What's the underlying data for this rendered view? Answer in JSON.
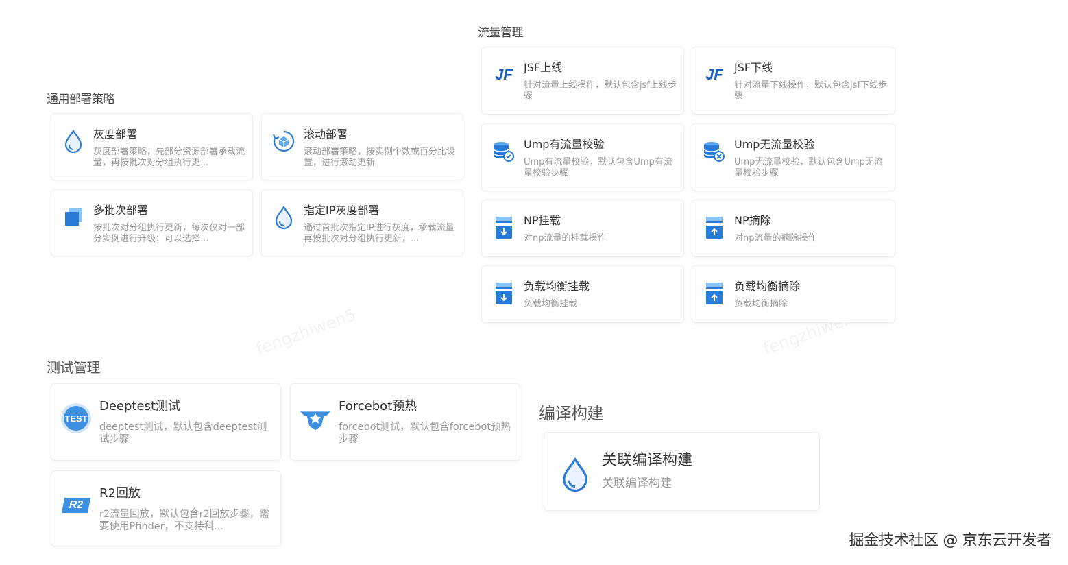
{
  "sections": {
    "deploy": "通用部署策略",
    "traffic": "流量管理",
    "test": "测试管理",
    "build": "编译构建"
  },
  "deploy_cards": [
    {
      "title": "灰度部署",
      "desc": "灰度部署策略，先部分资源部署承载流量，再按批次对分组执行更..."
    },
    {
      "title": "滚动部署",
      "desc": "滚动部署策略，按实例个数或百分比设置，进行滚动更新"
    },
    {
      "title": "多批次部署",
      "desc": "按批次对分组执行更新，每次仅对一部分实例进行升级；可以选择..."
    },
    {
      "title": "指定IP灰度部署",
      "desc": "通过首批次指定IP进行灰度，承载流量再按批次对分组执行更新，..."
    }
  ],
  "traffic_cards": [
    {
      "title": "JSF上线",
      "desc": "针对流量上线操作，默认包含jsf上线步骤",
      "icon_text": "JF"
    },
    {
      "title": "JSF下线",
      "desc": "针对流量下线操作，默认包含jsf下线步骤",
      "icon_text": "JF"
    },
    {
      "title": "Ump有流量校验",
      "desc": "Ump有流量校验，默认包含Ump有流量校验步骤"
    },
    {
      "title": "Ump无流量校验",
      "desc": "Ump无流量校验，默认包含Ump无流量校验步骤"
    },
    {
      "title": "NP挂载",
      "desc": "对np流量的挂载操作"
    },
    {
      "title": "NP摘除",
      "desc": "对np流量的摘除操作"
    },
    {
      "title": "负载均衡挂载",
      "desc": "负载均衡挂载"
    },
    {
      "title": "负载均衡摘除",
      "desc": "负载均衡摘除"
    }
  ],
  "test_cards": [
    {
      "title": "Deeptest测试",
      "desc": "deeptest测试，默认包含deeptest测试步骤",
      "icon_text": "TEST"
    },
    {
      "title": "Forcebot预热",
      "desc": "forcebot测试，默认包含forcebot预热步骤"
    },
    {
      "title": "R2回放",
      "desc": "r2流量回放，默认包含r2回放步骤，需要使用Pfinder，不支持科...",
      "icon_text": "R2"
    }
  ],
  "build_cards": [
    {
      "title": "关联编译构建",
      "desc": "关联编译构建"
    }
  ],
  "footer": "掘金技术社区 @ 京东云开发者",
  "watermark": "fengzhiwen5",
  "colors": {
    "blue": "#2a7bd8",
    "blue_light": "#5aa7ee",
    "jf": "#1b5fc2"
  }
}
